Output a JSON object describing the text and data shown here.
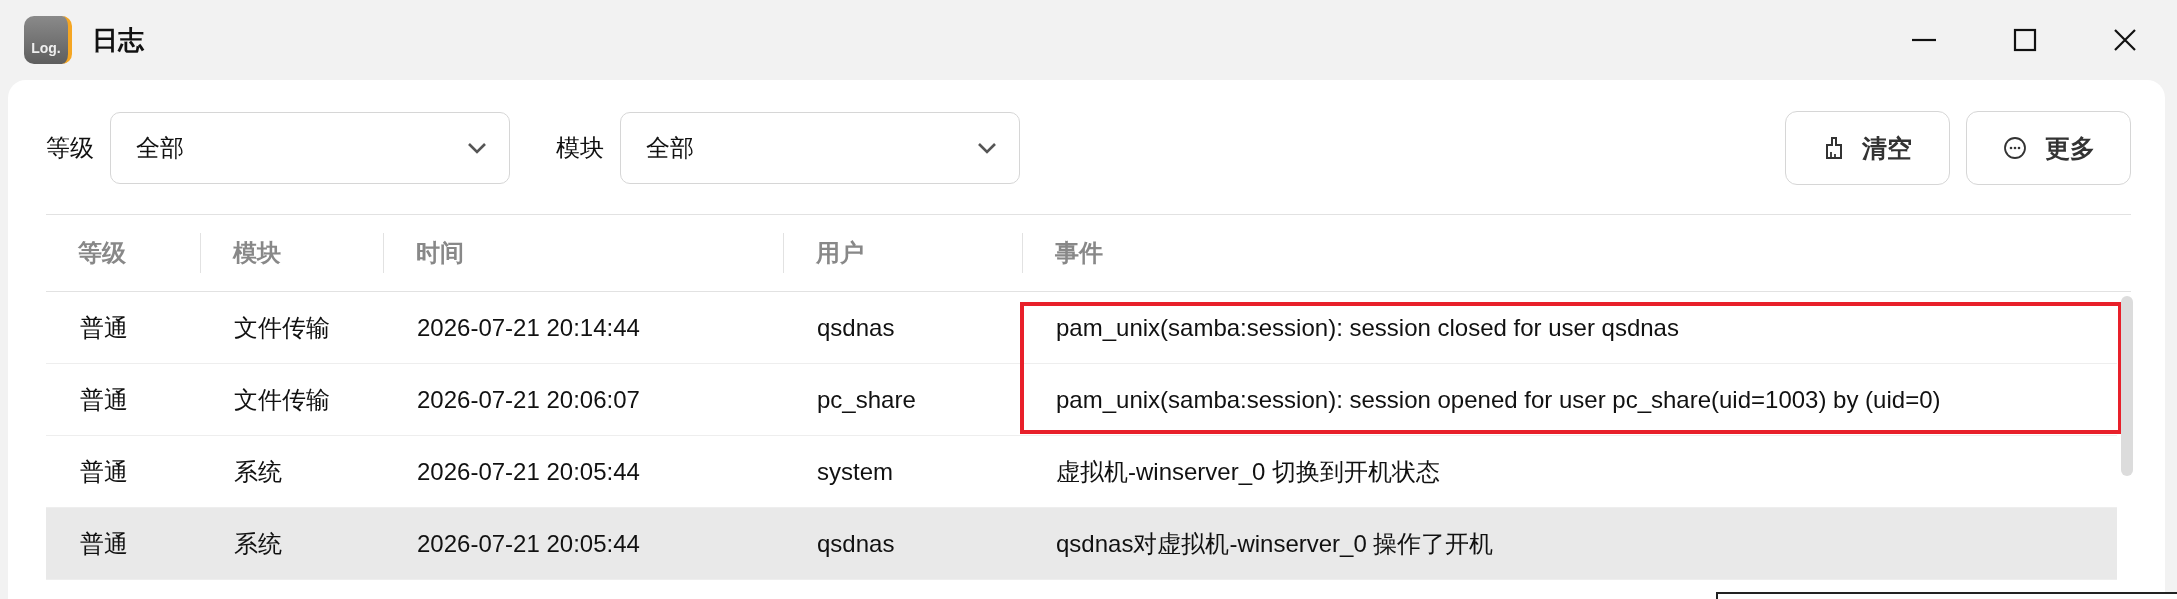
{
  "window": {
    "title": "日志",
    "logo_text": "Log."
  },
  "filters": [
    {
      "label": "等级",
      "value": "全部"
    },
    {
      "label": "模块",
      "value": "全部"
    }
  ],
  "buttons": [
    {
      "kind": "clear",
      "label": "清空"
    },
    {
      "kind": "more",
      "label": "更多"
    }
  ],
  "table": {
    "columns": [
      "等级",
      "模块",
      "时间",
      "用户",
      "事件"
    ],
    "rows": [
      {
        "selected": false,
        "highlighted": true,
        "cells": [
          "普通",
          "文件传输",
          "2026-07-21 20:14:44",
          "qsdnas",
          "pam_unix(samba:session): session closed for user qsdnas"
        ]
      },
      {
        "selected": false,
        "highlighted": true,
        "cells": [
          "普通",
          "文件传输",
          "2026-07-21 20:06:07",
          "pc_share",
          "pam_unix(samba:session): session opened for user pc_share(uid=1003) by (uid=0)"
        ]
      },
      {
        "selected": false,
        "highlighted": false,
        "cells": [
          "普通",
          "系统",
          "2026-07-21 20:05:44",
          "system",
          "虚拟机-winserver_0 切换到开机状态"
        ]
      },
      {
        "selected": true,
        "highlighted": false,
        "cells": [
          "普通",
          "系统",
          "2026-07-21 20:05:44",
          "qsdnas",
          "qsdnas对虚拟机-winserver_0 操作了开机"
        ]
      }
    ]
  }
}
